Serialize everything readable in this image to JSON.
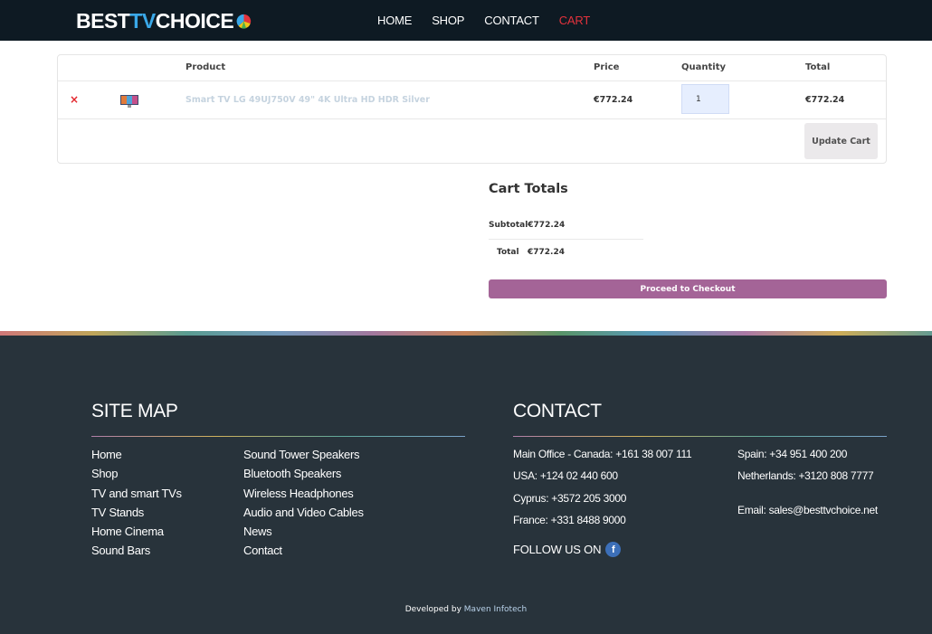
{
  "brand": {
    "part1": "BEST",
    "part2": "TV",
    "part3": "CHOICE"
  },
  "nav": {
    "home": "HOME",
    "shop": "SHOP",
    "contact": "CONTACT",
    "cart": "CART"
  },
  "cart": {
    "headers": {
      "product": "Product",
      "price": "Price",
      "quantity": "Quantity",
      "total": "Total"
    },
    "item": {
      "remove": "×",
      "name": "Smart TV LG 49UJ750V 49\" 4K Ultra HD HDR Silver",
      "price": "€772.24",
      "quantity": "1",
      "total": "€772.24"
    },
    "update_label": "Update Cart"
  },
  "totals": {
    "title": "Cart Totals",
    "subtotal_label": "Subtotal",
    "subtotal_value": "€772.24",
    "total_label": "Total",
    "total_value": "€772.24",
    "checkout_label": "Proceed to Checkout"
  },
  "footer": {
    "sitemap_title": "SITE MAP",
    "links_col1": [
      "Home",
      "Shop",
      "TV and smart TVs",
      "TV Stands",
      "Home Cinema",
      "Sound Bars"
    ],
    "links_col2": [
      "Sound Tower Speakers",
      "Bluetooth Speakers",
      "Wireless Headphones",
      "Audio and Video Cables",
      "News",
      "Contact"
    ],
    "contact_title": "CONTACT",
    "contacts_col1": [
      "Main Office - Canada: +161 38 007 111",
      "USA: +124 02 440 600",
      "Cyprus: +3572 205 3000",
      "France: +331 8488 9000"
    ],
    "contacts_col2": [
      "Spain: +34 951 400 200",
      "Netherlands: +3120 808 7777"
    ],
    "email": "Email: sales@besttvchoice.net",
    "follow": "FOLLOW US ON",
    "facebook_glyph": "f",
    "developed_by": "Developed by",
    "developer": "Maven Infotech"
  },
  "colors": {
    "header_bg": "#0e1a23",
    "accent_red": "#e3323c",
    "checkout_purple": "#a46497",
    "footer_bg": "#28333b"
  }
}
